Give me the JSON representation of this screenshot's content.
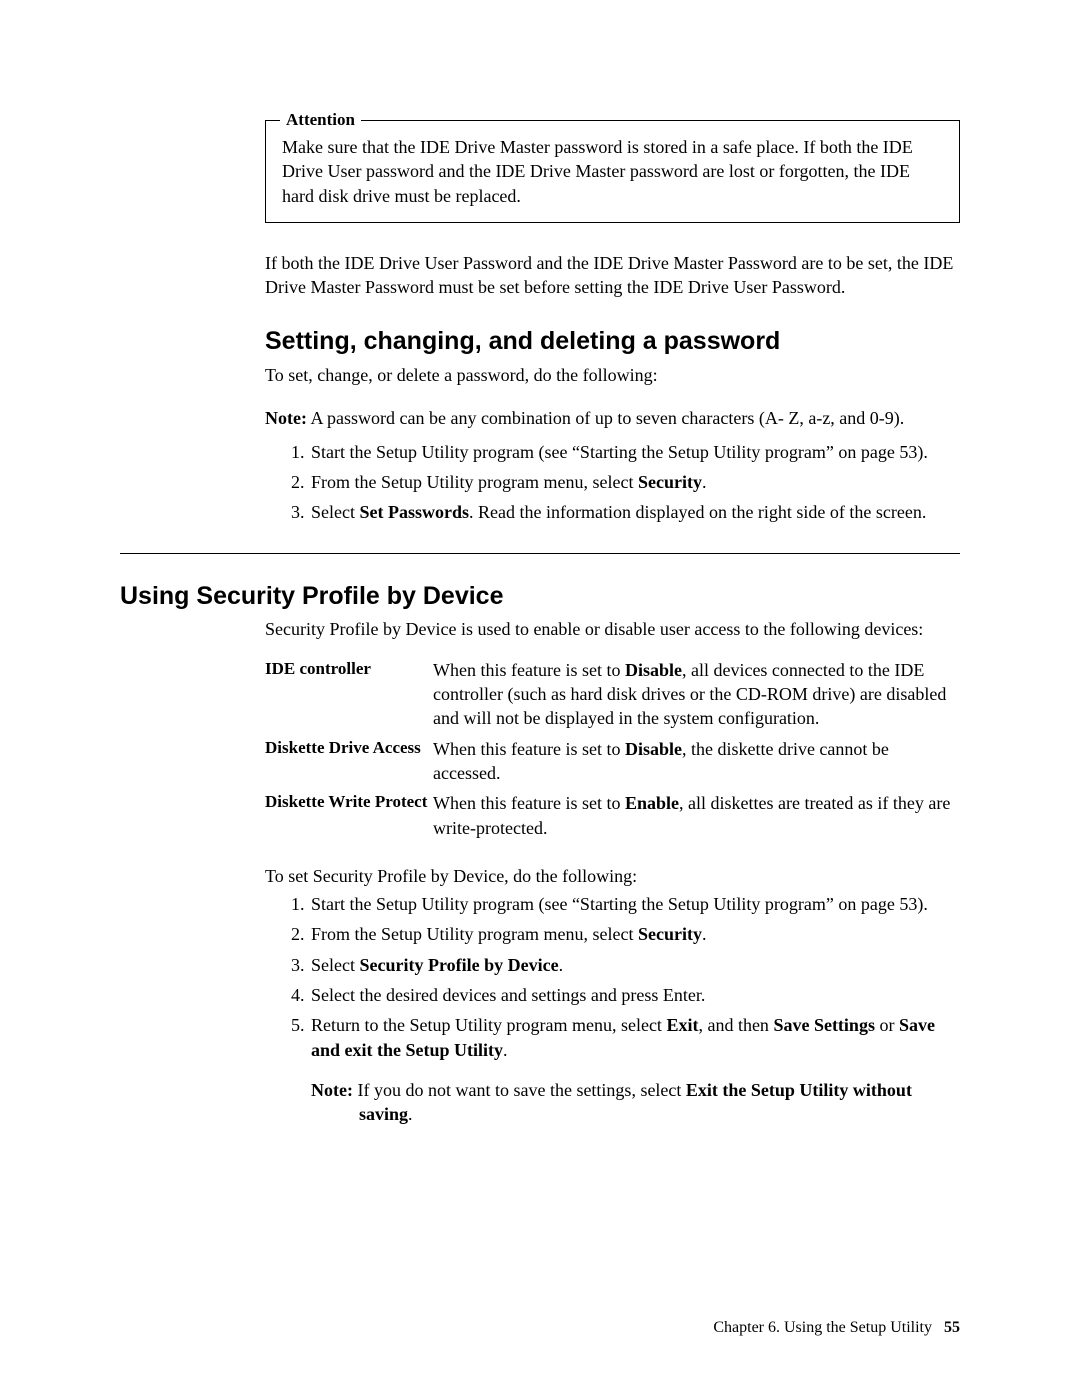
{
  "attention": {
    "label": "Attention",
    "text": "Make sure that the IDE Drive Master password is stored in a safe place. If both the IDE Drive User password and the IDE Drive Master password are lost or forgotten, the IDE hard disk drive must be replaced."
  },
  "intro_para": "If both the IDE Drive User Password and the IDE Drive Master Password are to be set, the IDE Drive Master Password must be set before setting the IDE Drive User Password.",
  "section1": {
    "title": "Setting, changing, and deleting a password",
    "lead": "To set, change, or delete a password, do the following:",
    "note_label": "Note:",
    "note_text": " A password can be any combination of up to seven characters (A- Z, a-z, and 0-9).",
    "step1": "Start the Setup Utility program (see “Starting the Setup Utility program” on page 53).",
    "step2_a": "From the Setup Utility program menu, select ",
    "step2_b": "Security",
    "step2_c": ".",
    "step3_a": "Select ",
    "step3_b": "Set Passwords",
    "step3_c": ". Read the information displayed on the right side of the screen."
  },
  "section2": {
    "title": "Using Security Profile by Device",
    "lead": "Security Profile by Device is used to enable or disable user access to the following devices:",
    "rows": {
      "r0": {
        "term": "IDE controller",
        "d1": "When this feature is set to ",
        "d2": "Disable",
        "d3": ", all devices connected to the IDE controller (such as hard disk drives or the CD-ROM drive) are disabled and will not be displayed in the system configuration."
      },
      "r1": {
        "term": "Diskette Drive Access",
        "d1": "When this feature is set to ",
        "d2": "Disable",
        "d3": ", the diskette drive cannot be accessed."
      },
      "r2": {
        "term": "Diskette Write Protect",
        "d1": "When this feature is set to ",
        "d2": "Enable",
        "d3": ", all diskettes are treated as if they are write-protected."
      }
    },
    "lead2": "To set Security Profile by Device, do the following:",
    "step1": "Start the Setup Utility program (see “Starting the Setup Utility program” on page 53).",
    "step2_a": "From the Setup Utility program menu, select ",
    "step2_b": "Security",
    "step2_c": ".",
    "step3_a": "Select ",
    "step3_b": "Security Profile by Device",
    "step3_c": ".",
    "step4": "Select the desired devices and settings and press Enter.",
    "step5_a": "Return to the Setup Utility program menu, select ",
    "step5_b": "Exit",
    "step5_c": ", and then ",
    "step5_d": "Save Settings",
    "step5_e": " or ",
    "step5_f": "Save and exit the Setup Utility",
    "step5_g": ".",
    "note2_label": "Note:",
    "note2_a": " If you do not want to save the settings, select ",
    "note2_b": "Exit the Setup Utility without saving",
    "note2_c": "."
  },
  "footer": {
    "chapter": "Chapter 6. Using the Setup Utility",
    "page": "55"
  }
}
